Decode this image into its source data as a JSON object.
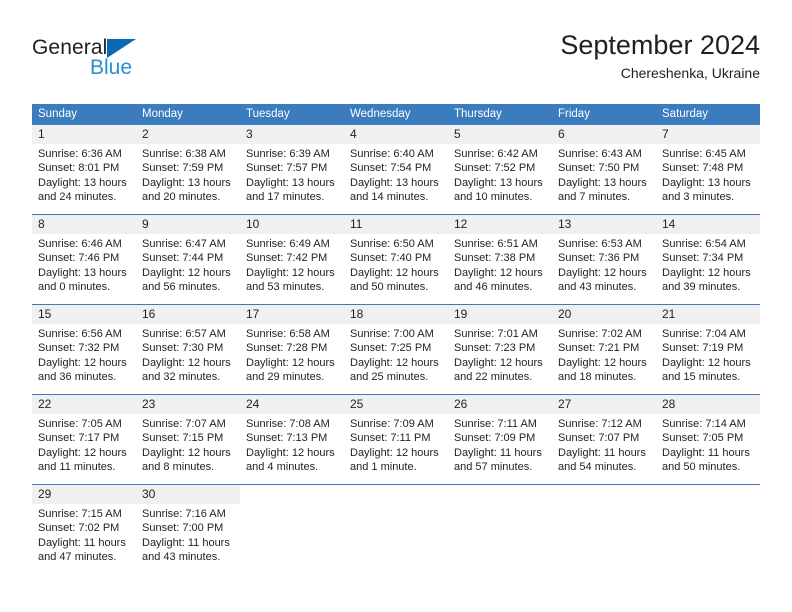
{
  "brand": {
    "name_dark": "General",
    "name_blue": "Blue",
    "triangle_icon": "triangle-icon",
    "accent_dark": "#231f20",
    "accent_blue": "#2a8fd4",
    "triangle_color": "#0a69b4"
  },
  "header": {
    "month_title": "September 2024",
    "location": "Chereshenka, Ukraine"
  },
  "calendar": {
    "header_color": "#3b7cbf",
    "daynum_band_color": "#f0f0f0",
    "weekday_headers": [
      "Sunday",
      "Monday",
      "Tuesday",
      "Wednesday",
      "Thursday",
      "Friday",
      "Saturday"
    ],
    "weeks": [
      [
        {
          "day": "1",
          "lines": [
            "Sunrise: 6:36 AM",
            "Sunset: 8:01 PM",
            "Daylight: 13 hours",
            "and 24 minutes."
          ]
        },
        {
          "day": "2",
          "lines": [
            "Sunrise: 6:38 AM",
            "Sunset: 7:59 PM",
            "Daylight: 13 hours",
            "and 20 minutes."
          ]
        },
        {
          "day": "3",
          "lines": [
            "Sunrise: 6:39 AM",
            "Sunset: 7:57 PM",
            "Daylight: 13 hours",
            "and 17 minutes."
          ]
        },
        {
          "day": "4",
          "lines": [
            "Sunrise: 6:40 AM",
            "Sunset: 7:54 PM",
            "Daylight: 13 hours",
            "and 14 minutes."
          ]
        },
        {
          "day": "5",
          "lines": [
            "Sunrise: 6:42 AM",
            "Sunset: 7:52 PM",
            "Daylight: 13 hours",
            "and 10 minutes."
          ]
        },
        {
          "day": "6",
          "lines": [
            "Sunrise: 6:43 AM",
            "Sunset: 7:50 PM",
            "Daylight: 13 hours",
            "and 7 minutes."
          ]
        },
        {
          "day": "7",
          "lines": [
            "Sunrise: 6:45 AM",
            "Sunset: 7:48 PM",
            "Daylight: 13 hours",
            "and 3 minutes."
          ]
        }
      ],
      [
        {
          "day": "8",
          "lines": [
            "Sunrise: 6:46 AM",
            "Sunset: 7:46 PM",
            "Daylight: 13 hours",
            "and 0 minutes."
          ]
        },
        {
          "day": "9",
          "lines": [
            "Sunrise: 6:47 AM",
            "Sunset: 7:44 PM",
            "Daylight: 12 hours",
            "and 56 minutes."
          ]
        },
        {
          "day": "10",
          "lines": [
            "Sunrise: 6:49 AM",
            "Sunset: 7:42 PM",
            "Daylight: 12 hours",
            "and 53 minutes."
          ]
        },
        {
          "day": "11",
          "lines": [
            "Sunrise: 6:50 AM",
            "Sunset: 7:40 PM",
            "Daylight: 12 hours",
            "and 50 minutes."
          ]
        },
        {
          "day": "12",
          "lines": [
            "Sunrise: 6:51 AM",
            "Sunset: 7:38 PM",
            "Daylight: 12 hours",
            "and 46 minutes."
          ]
        },
        {
          "day": "13",
          "lines": [
            "Sunrise: 6:53 AM",
            "Sunset: 7:36 PM",
            "Daylight: 12 hours",
            "and 43 minutes."
          ]
        },
        {
          "day": "14",
          "lines": [
            "Sunrise: 6:54 AM",
            "Sunset: 7:34 PM",
            "Daylight: 12 hours",
            "and 39 minutes."
          ]
        }
      ],
      [
        {
          "day": "15",
          "lines": [
            "Sunrise: 6:56 AM",
            "Sunset: 7:32 PM",
            "Daylight: 12 hours",
            "and 36 minutes."
          ]
        },
        {
          "day": "16",
          "lines": [
            "Sunrise: 6:57 AM",
            "Sunset: 7:30 PM",
            "Daylight: 12 hours",
            "and 32 minutes."
          ]
        },
        {
          "day": "17",
          "lines": [
            "Sunrise: 6:58 AM",
            "Sunset: 7:28 PM",
            "Daylight: 12 hours",
            "and 29 minutes."
          ]
        },
        {
          "day": "18",
          "lines": [
            "Sunrise: 7:00 AM",
            "Sunset: 7:25 PM",
            "Daylight: 12 hours",
            "and 25 minutes."
          ]
        },
        {
          "day": "19",
          "lines": [
            "Sunrise: 7:01 AM",
            "Sunset: 7:23 PM",
            "Daylight: 12 hours",
            "and 22 minutes."
          ]
        },
        {
          "day": "20",
          "lines": [
            "Sunrise: 7:02 AM",
            "Sunset: 7:21 PM",
            "Daylight: 12 hours",
            "and 18 minutes."
          ]
        },
        {
          "day": "21",
          "lines": [
            "Sunrise: 7:04 AM",
            "Sunset: 7:19 PM",
            "Daylight: 12 hours",
            "and 15 minutes."
          ]
        }
      ],
      [
        {
          "day": "22",
          "lines": [
            "Sunrise: 7:05 AM",
            "Sunset: 7:17 PM",
            "Daylight: 12 hours",
            "and 11 minutes."
          ]
        },
        {
          "day": "23",
          "lines": [
            "Sunrise: 7:07 AM",
            "Sunset: 7:15 PM",
            "Daylight: 12 hours",
            "and 8 minutes."
          ]
        },
        {
          "day": "24",
          "lines": [
            "Sunrise: 7:08 AM",
            "Sunset: 7:13 PM",
            "Daylight: 12 hours",
            "and 4 minutes."
          ]
        },
        {
          "day": "25",
          "lines": [
            "Sunrise: 7:09 AM",
            "Sunset: 7:11 PM",
            "Daylight: 12 hours",
            "and 1 minute."
          ]
        },
        {
          "day": "26",
          "lines": [
            "Sunrise: 7:11 AM",
            "Sunset: 7:09 PM",
            "Daylight: 11 hours",
            "and 57 minutes."
          ]
        },
        {
          "day": "27",
          "lines": [
            "Sunrise: 7:12 AM",
            "Sunset: 7:07 PM",
            "Daylight: 11 hours",
            "and 54 minutes."
          ]
        },
        {
          "day": "28",
          "lines": [
            "Sunrise: 7:14 AM",
            "Sunset: 7:05 PM",
            "Daylight: 11 hours",
            "and 50 minutes."
          ]
        }
      ],
      [
        {
          "day": "29",
          "lines": [
            "Sunrise: 7:15 AM",
            "Sunset: 7:02 PM",
            "Daylight: 11 hours",
            "and 47 minutes."
          ]
        },
        {
          "day": "30",
          "lines": [
            "Sunrise: 7:16 AM",
            "Sunset: 7:00 PM",
            "Daylight: 11 hours",
            "and 43 minutes."
          ]
        },
        {
          "day": "",
          "lines": []
        },
        {
          "day": "",
          "lines": []
        },
        {
          "day": "",
          "lines": []
        },
        {
          "day": "",
          "lines": []
        },
        {
          "day": "",
          "lines": []
        }
      ]
    ]
  }
}
